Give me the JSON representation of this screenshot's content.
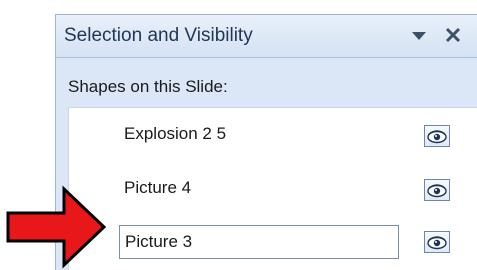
{
  "pane": {
    "title": "Selection and Visibility",
    "dropdown_icon": "chevron-down-icon",
    "close_icon": "close-icon",
    "section_label": "Shapes on this Slide:"
  },
  "shapes": [
    {
      "name": "Explosion 2 5",
      "visible": true,
      "editing": false
    },
    {
      "name": "Picture 4",
      "visible": true,
      "editing": false
    },
    {
      "name": "Picture 3",
      "visible": true,
      "editing": true
    }
  ],
  "colors": {
    "arrow_fill": "#e8181a",
    "arrow_stroke": "#000000",
    "pane_background": "#dbe7f6"
  }
}
